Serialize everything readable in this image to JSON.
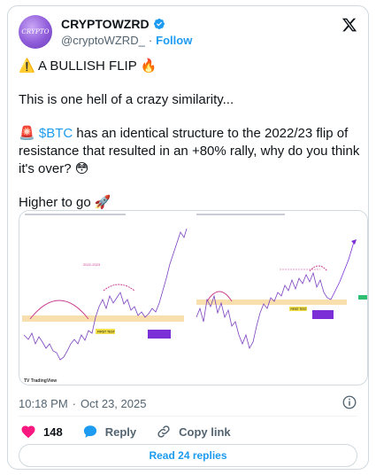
{
  "author": {
    "display_name": "CRYPTOWZRD",
    "handle": "@cryptoWZRD_",
    "separator": "·",
    "follow_label": "Follow",
    "avatar_text": "CRYPTO"
  },
  "tweet": {
    "line1": "⚠️ A BULLISH FLIP 🔥",
    "line2": "This is one hell of a crazy similarity...",
    "line3_prefix": "🚨 ",
    "cashtag": "$BTC",
    "line3_rest": " has an identical structure to the 2022/23 flip of",
    "line4": "resistance that resulted in an +80% rally, why do you think",
    "line5": "it's over? 😳",
    "line6": "Higher to go 🚀"
  },
  "media": {
    "left_chart_label": "2022-2023",
    "flip_label_left": "FIRST TEST",
    "flip_label_right": "FIRST TEST",
    "watermark": "TV TradingView",
    "accent_colors": {
      "candle_up": "#22a06b",
      "candle_down": "#7b3fbf",
      "arc": "#c83c8f",
      "support_band": "#f5d28a",
      "purple_tag": "#7b2fd6",
      "yellow_tag": "#f2e04a",
      "green_price": "#2fbf71"
    }
  },
  "meta": {
    "time": "10:18 PM",
    "dot": "·",
    "date": "Oct 23, 2025"
  },
  "actions": {
    "likes_count": "148",
    "reply_label": "Reply",
    "copy_link_label": "Copy link"
  },
  "read_replies_label": "Read 24 replies"
}
